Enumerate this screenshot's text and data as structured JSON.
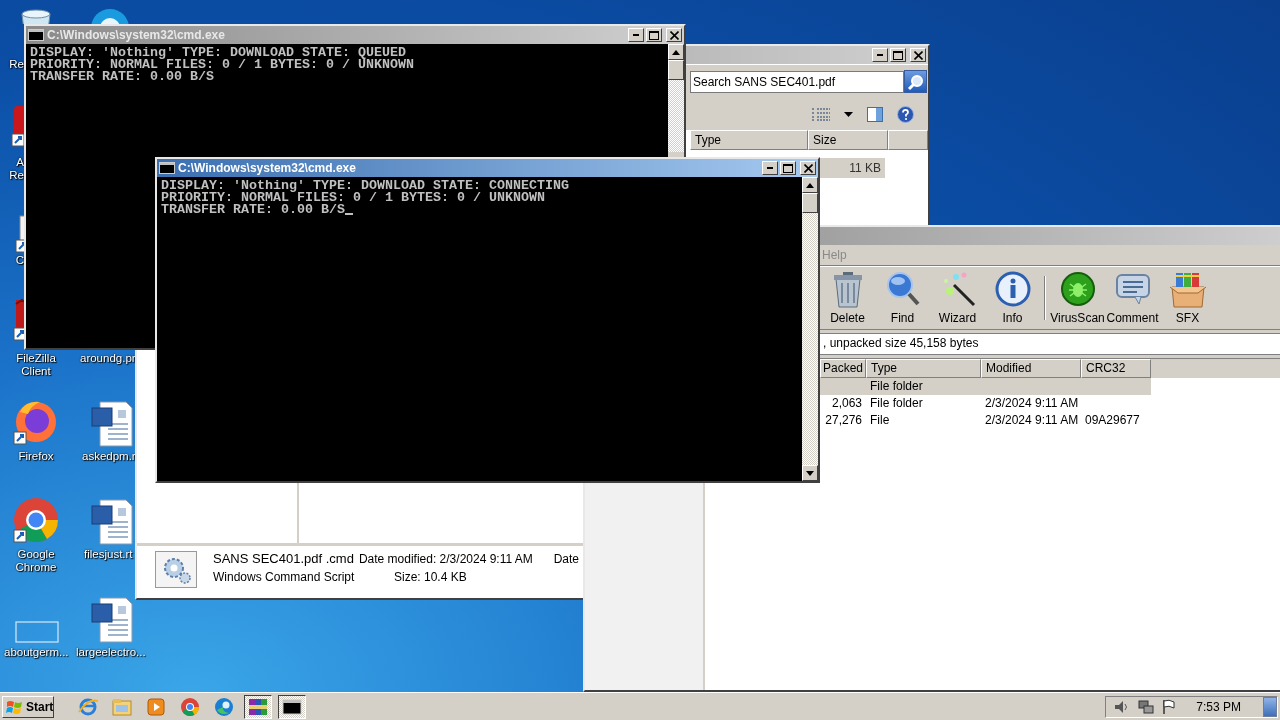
{
  "desktop_icons": [
    {
      "kind": "bin",
      "label": "Re"
    },
    {
      "kind": "blue-app"
    },
    {
      "kind": "red-app",
      "label": "A Re"
    },
    {
      "kind": "shortcut",
      "label": "C"
    },
    {
      "kind": "filezilla",
      "label": "FileZilla Client"
    },
    {
      "label": "aroundg.pr"
    },
    {
      "kind": "firefox",
      "label": "Firefox"
    },
    {
      "kind": "doc",
      "label": "askedpm.r"
    },
    {
      "kind": "chrome",
      "label": "Google Chrome"
    },
    {
      "kind": "doc",
      "label": "filesjust.rt"
    },
    {
      "kind": "blank",
      "label": "aboutgerm..."
    },
    {
      "kind": "doc",
      "label": "largeelectro..."
    }
  ],
  "explorer": {
    "search": {
      "placeholder": "Search SANS SEC401.pdf"
    },
    "columns": [
      "Type",
      "Size"
    ],
    "rows": [
      {
        "size": "11 KB",
        "selected": true
      }
    ],
    "details": {
      "name": "SANS SEC401.pdf .cmd",
      "date_modified": "Date modified: 2/3/2024 9:11 AM",
      "column_3": "Date",
      "type": "Windows Command Script",
      "size": "Size: 10.4 KB"
    }
  },
  "winrar": {
    "menu": [
      "Help"
    ],
    "toolbar": [
      {
        "kind": "delete",
        "label": "Delete"
      },
      {
        "kind": "find",
        "label": "Find"
      },
      {
        "kind": "wizard",
        "label": "Wizard"
      },
      {
        "kind": "info",
        "label": "Info"
      },
      {
        "kind": "virusscan",
        "label": "VirusScan"
      },
      {
        "kind": "comment",
        "label": "Comment"
      },
      {
        "kind": "sfx",
        "label": "SFX"
      }
    ],
    "status": ", unpacked size 45,158 bytes",
    "columns": [
      "Packed",
      "Type",
      "Modified",
      "CRC32"
    ],
    "rows": [
      {
        "cells": [
          "",
          "File folder",
          "",
          ""
        ],
        "selected": true
      },
      {
        "cells": [
          "2,063",
          "File folder",
          "2/3/2024 9:11 AM",
          ""
        ],
        "selected": false
      },
      {
        "cells": [
          "27,276",
          "File",
          "2/3/2024 9:11 AM",
          "09A29677"
        ],
        "selected": false
      }
    ]
  },
  "cmd_windows": [
    {
      "title": "C:\\Windows\\system32\\cmd.exe",
      "active": false,
      "cursor": false,
      "lines": [
        "DISPLAY: 'Nothing' TYPE: DOWNLOAD STATE: QUEUED",
        "PRIORITY: NORMAL FILES: 0 / 1 BYTES: 0 / UNKNOWN",
        "TRANSFER RATE: 0.00 B/S"
      ]
    },
    {
      "title": "C:\\Windows\\system32\\cmd.exe",
      "active": true,
      "cursor": true,
      "lines": [
        "DISPLAY: 'Nothing' TYPE: DOWNLOAD STATE: CONNECTING",
        "PRIORITY: NORMAL FILES: 0 / 1 BYTES: 0 / UNKNOWN",
        "TRANSFER RATE: 0.00 B/S"
      ]
    }
  ],
  "taskbar": {
    "start": "Start",
    "apps": [
      {
        "kind": "ie",
        "pressed": false
      },
      {
        "kind": "folder",
        "pressed": false
      },
      {
        "kind": "media",
        "pressed": false
      },
      {
        "kind": "chrome",
        "pressed": false
      },
      {
        "kind": "edge",
        "pressed": false
      },
      {
        "kind": "winrar",
        "pressed": true
      },
      {
        "kind": "cmd",
        "pressed": true
      }
    ],
    "clock": "7:53 PM"
  }
}
